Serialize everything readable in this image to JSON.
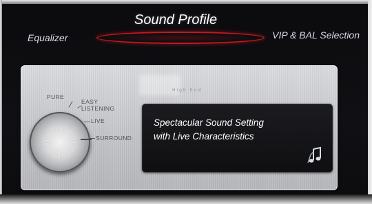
{
  "header": {
    "title": "Sound Profile",
    "left_tab": "Equalizer",
    "right_tab": "VIP & BAL Selection",
    "accent_color": "#c11a22"
  },
  "panel": {
    "brand_sub": "High End",
    "knob": {
      "options": [
        "PURE",
        "EASY LISTENING",
        "LIVE",
        "SURROUND"
      ],
      "easy_line1": "EASY",
      "easy_line2": "LISTENING",
      "selected": "LIVE"
    },
    "info": {
      "line1": "Spectacular Sound Setting",
      "line2": "with Live Characteristics",
      "icon": "music-note-icon"
    }
  }
}
